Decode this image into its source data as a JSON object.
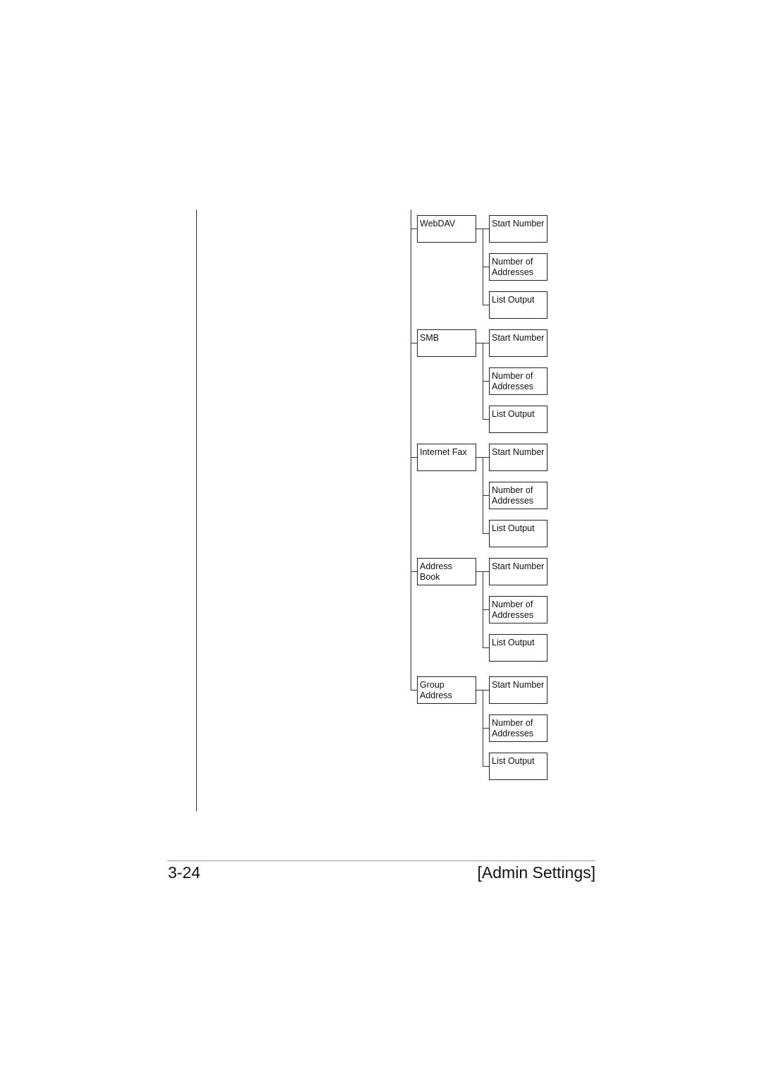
{
  "diagram": {
    "groups": [
      {
        "label": "WebDAV",
        "children": [
          "Start Number",
          "Number of\nAddresses",
          "List Output"
        ]
      },
      {
        "label": "SMB",
        "children": [
          "Start Number",
          "Number of\nAddresses",
          "List Output"
        ]
      },
      {
        "label": "Internet Fax",
        "children": [
          "Start Number",
          "Number of\nAddresses",
          "List Output"
        ]
      },
      {
        "label": "Address\nBook",
        "children": [
          "Start Number",
          "Number of\nAddresses",
          "List Output"
        ]
      },
      {
        "label": "Group\nAddress",
        "children": [
          "Start Number",
          "Number of\nAddresses",
          "List Output"
        ]
      }
    ]
  },
  "footer": {
    "page_number": "3-24",
    "section_title": "[Admin Settings]"
  }
}
